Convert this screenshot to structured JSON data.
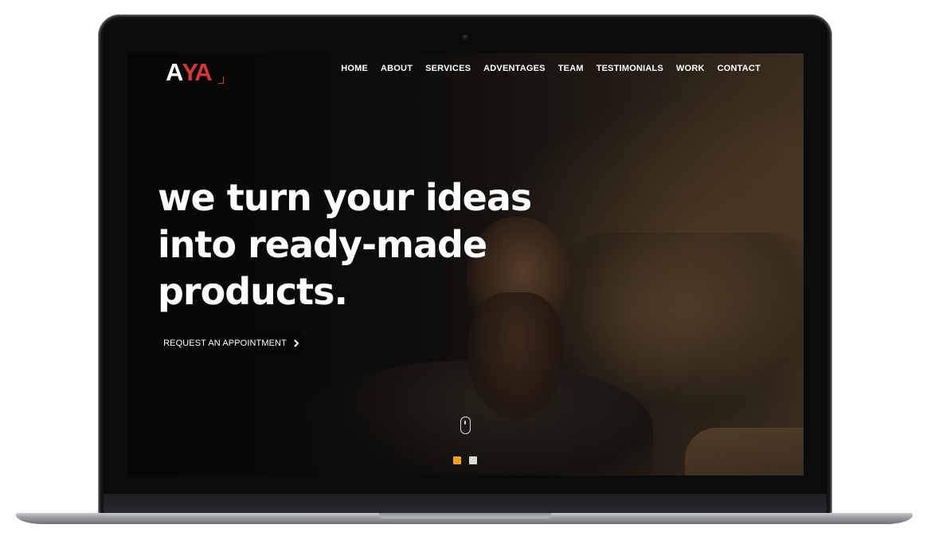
{
  "logo": {
    "part1": "A",
    "part2": "YA"
  },
  "nav": {
    "items": [
      {
        "label": "HOME"
      },
      {
        "label": "ABOUT"
      },
      {
        "label": "SERVICES"
      },
      {
        "label": "ADVENTAGES"
      },
      {
        "label": "TEAM"
      },
      {
        "label": "TESTIMONIALS"
      },
      {
        "label": "WORK"
      },
      {
        "label": "CONTACT"
      }
    ]
  },
  "hero": {
    "lines": [
      "we turn your ideas",
      "into ready-made",
      "products."
    ],
    "cta_label": "REQUEST AN APPOINTMENT",
    "cta_icon": "chevron-right-icon"
  },
  "slider": {
    "dots": [
      {
        "state": "active",
        "color": "#f0a020"
      },
      {
        "state": "inactive",
        "color": "#d9d9d9"
      }
    ]
  },
  "colors": {
    "brand_red": "#d8353b",
    "accent_orange": "#f0a020",
    "text": "#ffffff"
  }
}
